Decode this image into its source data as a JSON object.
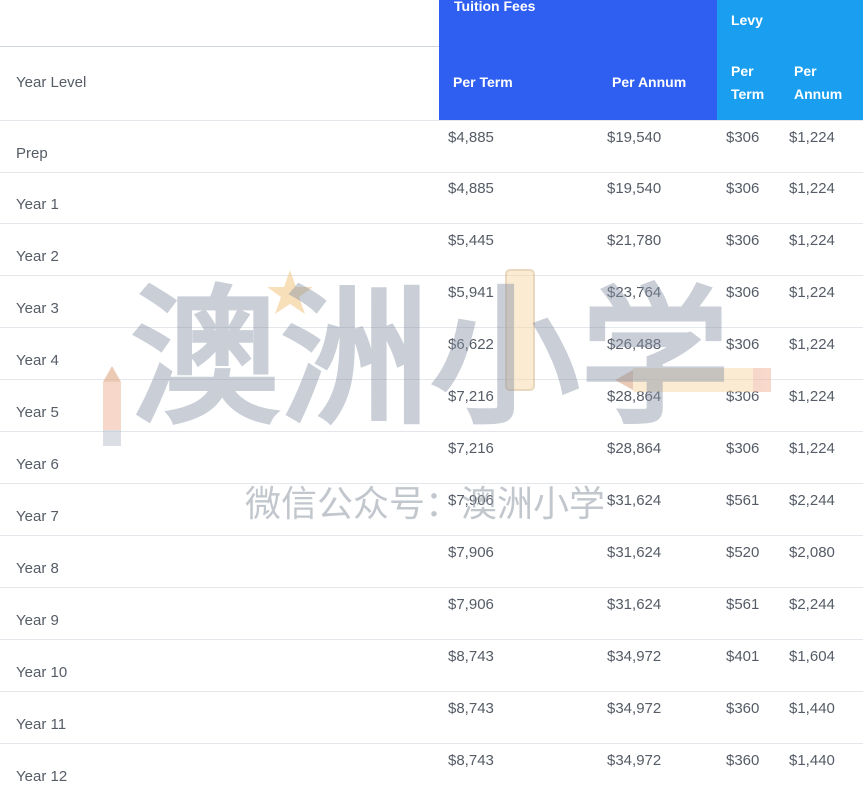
{
  "header": {
    "tuition_fees": "Tuition Fees",
    "levy": "Levy",
    "year_level": "Year Level",
    "tuition_per_term": "Per Term",
    "tuition_per_annum": "Per Annum",
    "levy_per_term_1": "Per",
    "levy_per_term_2": "Term",
    "levy_per_annum_1": "Per",
    "levy_per_annum_2": "Annum"
  },
  "rows": [
    {
      "year": "Prep",
      "tuition_term": "$4,885",
      "tuition_annum": "$19,540",
      "levy_term": "$306",
      "levy_annum": "$1,224"
    },
    {
      "year": "Year 1",
      "tuition_term": "$4,885",
      "tuition_annum": "$19,540",
      "levy_term": "$306",
      "levy_annum": "$1,224"
    },
    {
      "year": "Year 2",
      "tuition_term": "$5,445",
      "tuition_annum": "$21,780",
      "levy_term": "$306",
      "levy_annum": "$1,224"
    },
    {
      "year": "Year 3",
      "tuition_term": "$5,941",
      "tuition_annum": "$23,764",
      "levy_term": "$306",
      "levy_annum": "$1,224"
    },
    {
      "year": "Year 4",
      "tuition_term": "$6,622",
      "tuition_annum": "$26,488",
      "levy_term": "$306",
      "levy_annum": "$1,224"
    },
    {
      "year": "Year 5",
      "tuition_term": "$7,216",
      "tuition_annum": "$28,864",
      "levy_term": "$306",
      "levy_annum": "$1,224"
    },
    {
      "year": "Year 6",
      "tuition_term": "$7,216",
      "tuition_annum": "$28,864",
      "levy_term": "$306",
      "levy_annum": "$1,224"
    },
    {
      "year": "Year 7",
      "tuition_term": "$7,906",
      "tuition_annum": "$31,624",
      "levy_term": "$561",
      "levy_annum": "$2,244"
    },
    {
      "year": "Year 8",
      "tuition_term": "$7,906",
      "tuition_annum": "$31,624",
      "levy_term": "$520",
      "levy_annum": "$2,080"
    },
    {
      "year": "Year 9",
      "tuition_term": "$7,906",
      "tuition_annum": "$31,624",
      "levy_term": "$561",
      "levy_annum": "$2,244"
    },
    {
      "year": "Year 10",
      "tuition_term": "$8,743",
      "tuition_annum": "$34,972",
      "levy_term": "$401",
      "levy_annum": "$1,604"
    },
    {
      "year": "Year 11",
      "tuition_term": "$8,743",
      "tuition_annum": "$34,972",
      "levy_term": "$360",
      "levy_annum": "$1,440"
    },
    {
      "year": "Year 12",
      "tuition_term": "$8,743",
      "tuition_annum": "$34,972",
      "levy_term": "$360",
      "levy_annum": "$1,440"
    }
  ],
  "watermark": {
    "logo_text": "澳洲小学",
    "caption": "微信公众号：澳洲小学"
  },
  "colors": {
    "tuition_header": "#2f5ff1",
    "levy_header": "#1a9ff0",
    "body_text": "#555c66"
  }
}
